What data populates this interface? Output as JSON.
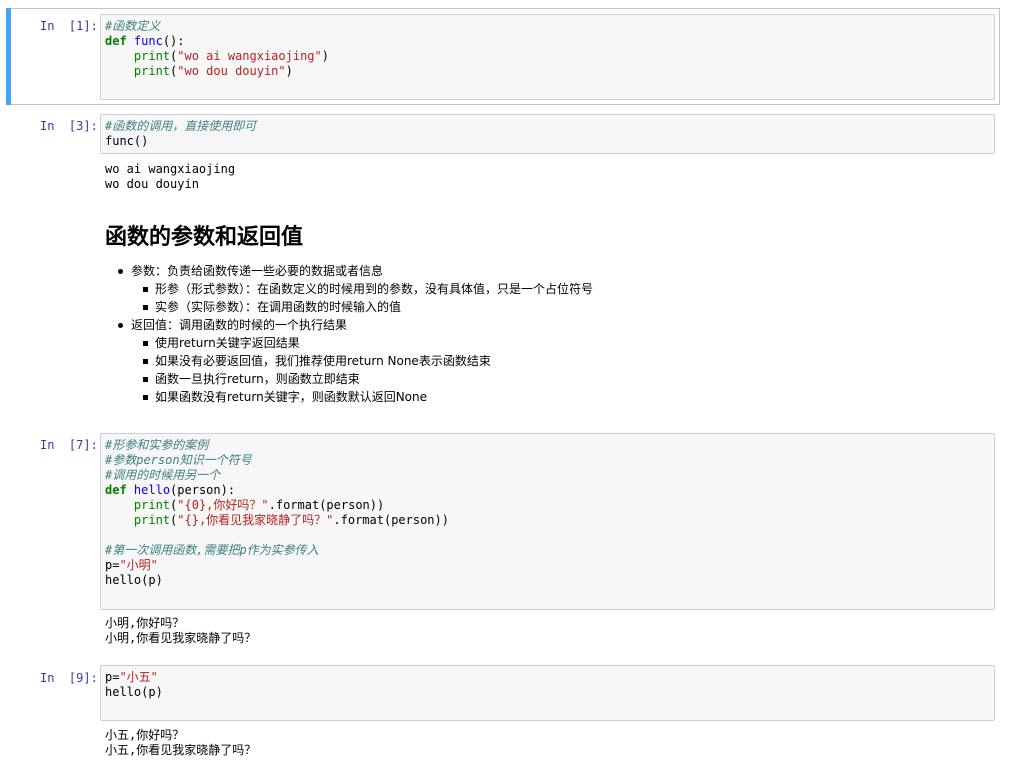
{
  "cells": {
    "c1": {
      "prompt": "In  [1]:",
      "line1": "#函数定义",
      "kw_def": "def",
      "fname": "func",
      "sig_rest": "():",
      "indent": "    ",
      "print_kw": "print",
      "p1_open": "(",
      "p1_str": "\"wo ai wangxiaojing\"",
      "p1_close": ")",
      "p2_open": "(",
      "p2_str": "\"wo dou douyin\"",
      "p2_close": ")"
    },
    "c3": {
      "prompt": "In  [3]:",
      "comment": "#函数的调用，直接使用即可",
      "call": "func()",
      "out1": "wo ai wangxiaojing",
      "out2": "wo dou douyin"
    },
    "markdown": {
      "heading": "函数的参数和返回值",
      "items": [
        "参数：负责给函数传递一些必要的数据或者信息",
        "形参（形式参数）：在函数定义的时候用到的参数，没有具体值，只是一个占位符号",
        "实参（实际参数）：在调用函数的时候输入的值",
        "返回值：调用函数的时候的一个执行结果",
        "使用return关键字返回结果",
        "如果没有必要返回值，我们推荐使用return None表示函数结束",
        "函数一旦执行return，则函数立即结束",
        "如果函数没有return关键字，则函数默认返回None"
      ]
    },
    "c7": {
      "prompt": "In  [7]:",
      "cm1": "#形参和实参的案例",
      "cm2": "#参数person知识一个符号",
      "cm3": "#调用的时候用另一个",
      "kw_def": "def",
      "fname": "hello",
      "sig_rest": "(person):",
      "indent": "    ",
      "print_kw": "print",
      "s1_open": "(",
      "s1_str": "\"{0},你好吗？\"",
      "s1_rest": ".format(person))",
      "s2_open": "(",
      "s2_str": "\"{},你看见我家晓静了吗？\"",
      "s2_rest": ".format(person))",
      "cm4": "#第一次调用函数,需要把p作为实参传入",
      "assign_lhs": "p=",
      "assign_str": "\"小明\"",
      "call": "hello(p)",
      "out1": "小明,你好吗？",
      "out2": "小明,你看见我家晓静了吗？"
    },
    "c9": {
      "prompt": "In  [9]:",
      "assign_lhs": "p=",
      "assign_str": "\"小五\"",
      "call": "hello(p)",
      "out1": "小五,你好吗？",
      "out2": "小五,你看见我家晓静了吗？"
    }
  }
}
